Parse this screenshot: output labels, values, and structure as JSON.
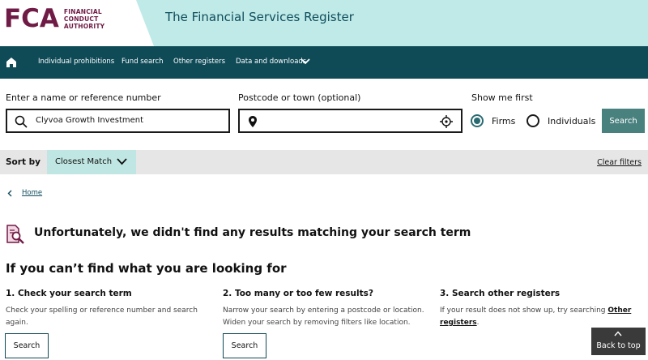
{
  "header": {
    "logo_mark": "FCA",
    "logo_lines": [
      "FINANCIAL",
      "CONDUCT",
      "AUTHORITY"
    ],
    "title": "The Financial Services Register"
  },
  "nav": {
    "home_icon": "home-icon",
    "items": [
      "Individual prohibitions",
      "Fund search",
      "Other registers",
      "Data and downloads"
    ]
  },
  "search": {
    "name_label": "Enter a name or reference number",
    "name_value": "Clyvoa Growth Investment",
    "postcode_label": "Postcode or town (optional)",
    "postcode_value": "",
    "show_me_first_label": "Show me first",
    "options": [
      {
        "label": "Firms",
        "checked": true
      },
      {
        "label": "Individuals",
        "checked": false
      }
    ],
    "button_label": "Search"
  },
  "sort": {
    "label": "Sort by",
    "selected": "Closest Match",
    "clear_filters": "Clear filters"
  },
  "breadcrumb": {
    "home": "Home"
  },
  "no_results": {
    "message": "Unfortunately, we didn't find any results matching your search term"
  },
  "help": {
    "title": "If you can’t find what you are looking for",
    "columns": [
      {
        "title": "1. Check your search term",
        "text": "Check your spelling or reference number and search again.",
        "button": "Search"
      },
      {
        "title": "2. Too many or too few results?",
        "text": "Narrow your search by entering a postcode or location. Widen your search by removing filters like location.",
        "button": "Search"
      },
      {
        "title": "3. Search other registers",
        "text_prefix": "If your result does not show up, try searching ",
        "link": "Other registers",
        "text_suffix": "."
      }
    ]
  },
  "back_to_top": "Back to top",
  "colors": {
    "brand": "#701b45",
    "nav_bg": "#0f4a57",
    "header_band": "#bfeae7",
    "accent": "#49817f"
  }
}
